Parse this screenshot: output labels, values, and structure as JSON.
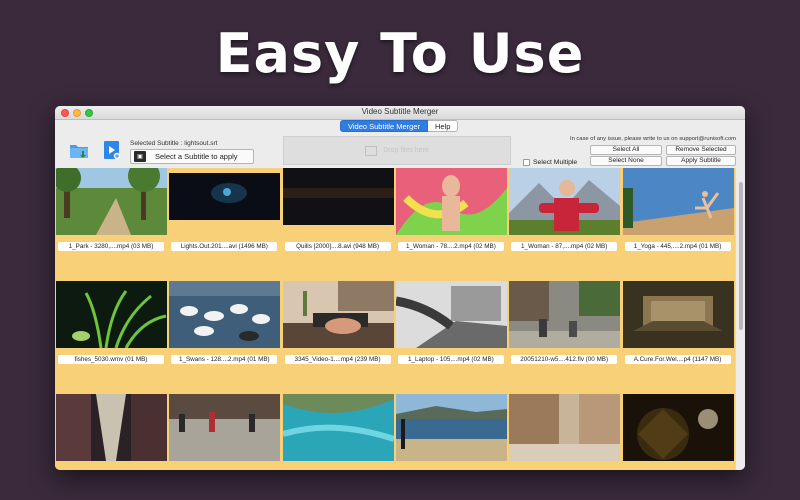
{
  "headline": "Easy To Use",
  "window": {
    "title": "Video Subtitle Merger",
    "tabs": [
      {
        "label": "Video Subtitle Merger",
        "active": true
      },
      {
        "label": "Help",
        "active": false
      }
    ]
  },
  "toolbar": {
    "selected_subtitle": "Selected Subtitle : lightsout.srt",
    "select_subtitle_button": "Select a Subtitle to apply",
    "dropzone_label": "Drop files here",
    "issue_note": "In case of any issue, please write to us on support@runisoft.com",
    "select_all": "Select All",
    "remove_selected": "Remove Selected",
    "select_multiple": "Select Multiple",
    "select_none": "Select None",
    "apply_subtitle": "Apply Subtitle"
  },
  "colors": {
    "grid_background": "#f7d078",
    "active_tab": "#2f7de0"
  },
  "files": [
    {
      "caption": "1_Park - 3280,....mp4 (03 MB)",
      "thumb": "park"
    },
    {
      "caption": "Lights.Out.201....avi (1496 MB)",
      "thumb": "lights"
    },
    {
      "caption": "Quills [2000]....8.avi (948 MB)",
      "thumb": "quills"
    },
    {
      "caption": "1_Woman - 78....2.mp4 (02 MB)",
      "thumb": "woman1"
    },
    {
      "caption": "1_Woman - 87,....mp4 (02 MB)",
      "thumb": "woman2"
    },
    {
      "caption": "1_Yoga - 445,....2.mp4 (01 MB)",
      "thumb": "yoga"
    },
    {
      "caption": "fishes_5030.wmv (01 MB)",
      "thumb": "fishes"
    },
    {
      "caption": "1_Swans - 128....2.mp4 (01 MB)",
      "thumb": "swans"
    },
    {
      "caption": "3345_Video-1....mp4 (239 MB)",
      "thumb": "desk"
    },
    {
      "caption": "1_Laptop - 105....mp4 (02 MB)",
      "thumb": "laptop"
    },
    {
      "caption": "20051210-w5....412.flv (00 MB)",
      "thumb": "street"
    },
    {
      "caption": "A.Cure.For.Wel....p4 (1147 MB)",
      "thumb": "fox"
    },
    {
      "caption": "",
      "thumb": "alley"
    },
    {
      "caption": "",
      "thumb": "plaza"
    },
    {
      "caption": "",
      "thumb": "reef"
    },
    {
      "caption": "",
      "thumb": "beach"
    },
    {
      "caption": "",
      "thumb": "town"
    },
    {
      "caption": "",
      "thumb": "sparkle"
    }
  ]
}
